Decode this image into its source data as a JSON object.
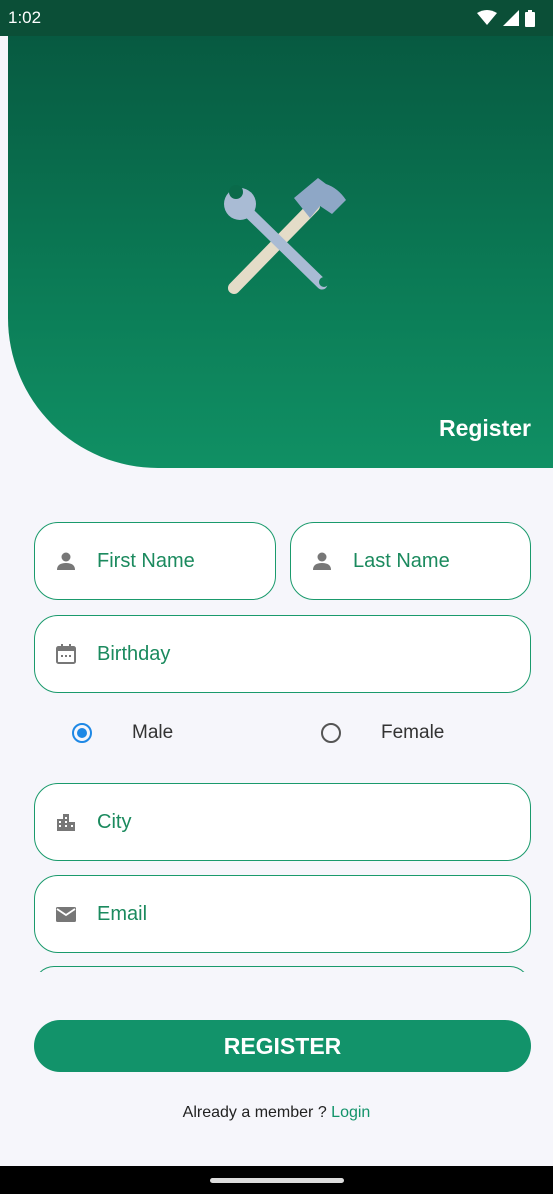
{
  "status": {
    "time": "1:02"
  },
  "header": {
    "title": "Register"
  },
  "form": {
    "first_name": "First Name",
    "last_name": "Last Name",
    "birthday": "Birthday",
    "gender": {
      "male": "Male",
      "female": "Female",
      "selected": "Male"
    },
    "city": "City",
    "email": "Email"
  },
  "actions": {
    "register": "REGISTER"
  },
  "footer": {
    "prompt": "Already a member ?",
    "login": "Login"
  },
  "colors": {
    "accent": "#12936a",
    "header_dark": "#0b4f37"
  }
}
